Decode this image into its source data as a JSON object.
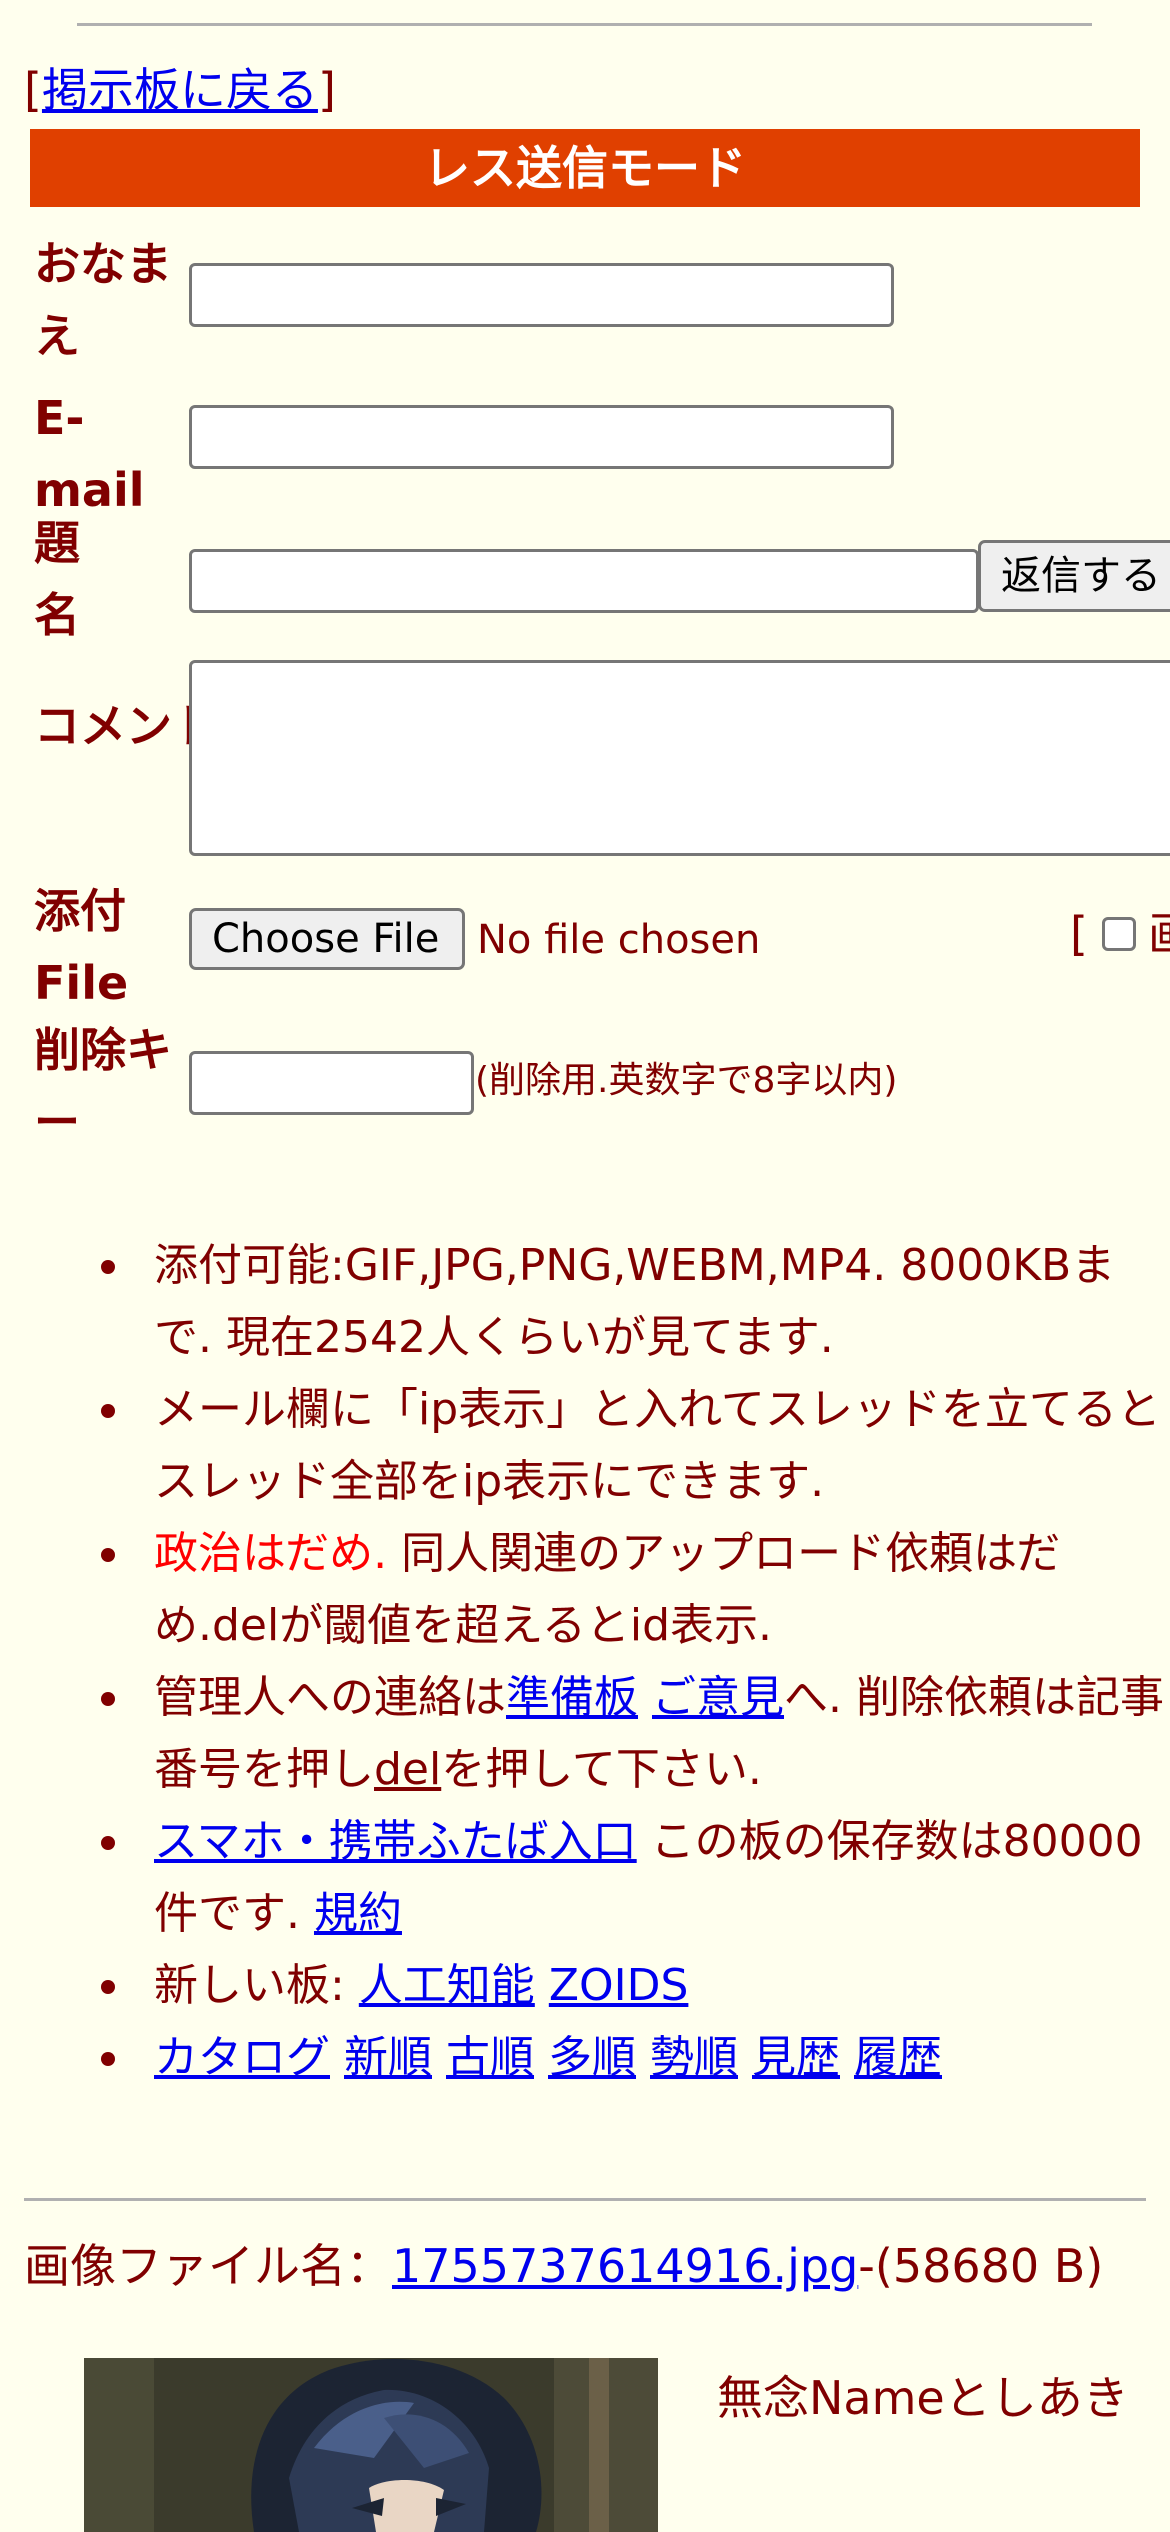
{
  "nav": {
    "back_open": "[",
    "back_label": "掲示板に戻る",
    "back_close": "]"
  },
  "form": {
    "mode_title": "レス送信モード",
    "name_label": "おなまえ",
    "email_label": "E-mail",
    "subject_label": "題名",
    "submit_label": "返信する",
    "comment_label": "コメント",
    "file_label": "添付File",
    "choose_file_label": "Choose File",
    "no_file_text": "No file chosen",
    "image_option_bracket": "[",
    "image_option_char": "画",
    "delete_key_label": "削除キー",
    "delete_key_hint": "(削除用.英数字で8字以内)"
  },
  "notes": {
    "n1": "添付可能:GIF,JPG,PNG,WEBM,MP4. 8000KBまで. 現在2542人くらいが見てます.",
    "n2": "メール欄に「ip表示」と入れてスレッドを立てるとスレッド全部をip表示にできます.",
    "n3_red": "政治はだめ.",
    "n3_rest": " 同人関連のアップロード依頼はだめ.delが閾値を超えるとid表示.",
    "n4_a": "管理人への連絡は",
    "n4_link1": "準備板",
    "n4_link2": "ご意見",
    "n4_b": "へ. 削除依頼は記事番号を押し",
    "n4_link3": "del",
    "n4_c": "を押して下さい.",
    "n5_link": "スマホ・携帯ふたば入口",
    "n5_text": " この板の保存数は80000件です. ",
    "n5_link2": "規約",
    "new_boards_label": "新しい板: ",
    "new_board_1": "人工知能",
    "new_board_2": "ZOIDS",
    "catalog": [
      "カタログ",
      "新順",
      "古順",
      "多順",
      "勢順",
      "見歴",
      "履歴"
    ]
  },
  "post": {
    "file_prefix": "画像ファイル名：",
    "file_name": "1755737614916.jpg",
    "file_size": "-(58680 B)",
    "subject_line": "無念Nameとしあき"
  },
  "colors": {
    "background": "#ffffee",
    "text": "#800000",
    "mode_bar": "#e04000",
    "link": "#0000ee",
    "warning": "#ff0000"
  }
}
